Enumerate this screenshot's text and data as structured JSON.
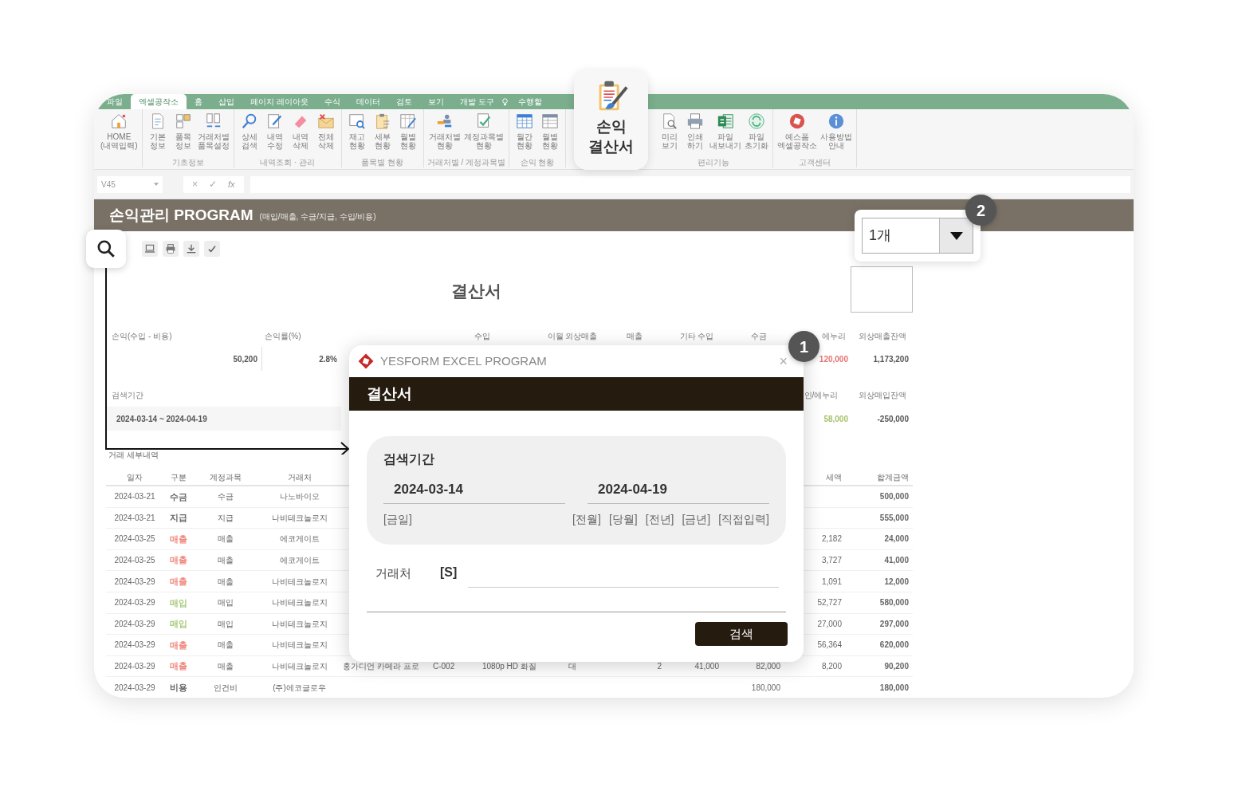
{
  "ribbon_tabs": [
    {
      "label": "파일",
      "selected": false
    },
    {
      "label": "엑셀공작소",
      "selected": true
    },
    {
      "label": "홈",
      "selected": false
    },
    {
      "label": "삽입",
      "selected": false
    },
    {
      "label": "페이지 레이아웃",
      "selected": false
    },
    {
      "label": "수식",
      "selected": false
    },
    {
      "label": "데이터",
      "selected": false
    },
    {
      "label": "검토",
      "selected": false
    },
    {
      "label": "보기",
      "selected": false
    },
    {
      "label": "개발 도구",
      "selected": false
    },
    {
      "label": "수행할",
      "selected": false
    }
  ],
  "ribbon_groups": [
    {
      "buttons": [
        "HOME\n(내역입력)"
      ]
    },
    {
      "label": "기초정보",
      "buttons": [
        "기본\n정보",
        "품목\n정보",
        "거래처별\n품목설정"
      ]
    },
    {
      "label": "내역조회 · 관리",
      "buttons": [
        "상세\n검색",
        "내역\n수정",
        "내역\n삭제",
        "전체\n삭제"
      ]
    },
    {
      "label": "품목별 현황",
      "buttons": [
        "재고\n현황",
        "세부\n현황",
        "월별\n현황"
      ]
    },
    {
      "label": "거래처별 / 계정과목별",
      "buttons": [
        "거래처별\n현황",
        "계정과목별\n현황"
      ]
    },
    {
      "label": "손익 현황",
      "buttons": [
        "월간\n현황",
        "월별\n현황"
      ]
    },
    {
      "label": "편리기능",
      "buttons": [
        "미리\n보기",
        "인쇄\n하기",
        "파일\n내보내기",
        "파일\n초기화"
      ]
    },
    {
      "label": "고객센터",
      "buttons": [
        "예스폼\n엑셀공작소",
        "사용방법\n안내"
      ]
    }
  ],
  "formula_bar": {
    "cell_ref": "V45",
    "buttons": [
      "×",
      "✓"
    ],
    "function_label": "fx"
  },
  "app_header": {
    "title": "손익관리 PROGRAM",
    "subtitle": "(매입/매출, 수금/지급, 수입/비용)"
  },
  "report_title": "결산서",
  "summary": [
    {
      "label": "손익(수입 - 비용)",
      "value": "50,200"
    },
    {
      "label": "손익률(%)",
      "value": "2.8%"
    },
    {
      "label": "수입"
    },
    {
      "label": "이월 외상매출"
    },
    {
      "label": "매출"
    },
    {
      "label": "기타 수입"
    },
    {
      "label": "수금"
    },
    {
      "label": "에누리",
      "value": "120,000",
      "color": "#e57373"
    },
    {
      "label": "외상매출잔액",
      "value": "1,173,200",
      "color": "#555555"
    }
  ],
  "summary_2": [
    {
      "label": "검색기간",
      "value": "2024-03-14 ~ 2024-04-19"
    },
    {
      "label": "인/에누리",
      "value": "58,000",
      "color": "#a5c26b"
    },
    {
      "label": "외상매입잔액",
      "value": "-250,000",
      "color": "#555555"
    }
  ],
  "detail_title": "거래 세부내역",
  "table": {
    "columns": [
      "일자",
      "구분",
      "계정과목",
      "거래처",
      "세액",
      "합계금액"
    ],
    "rows": [
      {
        "date": "2024-03-21",
        "type": "수금",
        "color": "#666666",
        "account": "수금",
        "vendor": "나노바이오",
        "total": "500,000"
      },
      {
        "date": "2024-03-21",
        "type": "지급",
        "color": "#666666",
        "account": "지급",
        "vendor": "나비테크놀로지",
        "total": "555,000"
      },
      {
        "date": "2024-03-25",
        "type": "매출",
        "color": "#f08a80",
        "account": "매출",
        "vendor": "에코게이트",
        "tax": "2,182",
        "total": "24,000"
      },
      {
        "date": "2024-03-25",
        "type": "매출",
        "color": "#f08a80",
        "account": "매출",
        "vendor": "에코게이트",
        "tax": "3,727",
        "total": "41,000"
      },
      {
        "date": "2024-03-29",
        "type": "매출",
        "color": "#f08a80",
        "account": "매출",
        "vendor": "나비테크놀로지",
        "tax": "1,091",
        "total": "12,000"
      },
      {
        "date": "2024-03-29",
        "type": "매입",
        "color": "#a8c97a",
        "account": "매입",
        "vendor": "나비테크놀로지",
        "tax": "52,727",
        "total": "580,000"
      },
      {
        "date": "2024-03-29",
        "type": "매입",
        "color": "#a8c97a",
        "account": "매입",
        "vendor": "나비테크놀로지",
        "tax": "27,000",
        "total": "297,000"
      },
      {
        "date": "2024-03-29",
        "type": "매출",
        "color": "#f08a80",
        "account": "매출",
        "vendor": "나비테크놀로지",
        "tax": "56,364",
        "total": "620,000"
      },
      {
        "date": "2024-03-29",
        "type": "매출",
        "color": "#f08a80",
        "account": "매출",
        "vendor": "나비테크놀로지",
        "item": "홍가디언 카메라 프로",
        "code": "C-002",
        "spec": "1080p HD 화질",
        "unit": "대",
        "qty": "2",
        "price": "41,000",
        "supply": "82,000",
        "tax": "8,200",
        "total": "90,200"
      },
      {
        "date": "2024-03-29",
        "type": "비용",
        "color": "#666666",
        "account": "인건비",
        "vendor": "(주)에코글로우",
        "supply": "180,000",
        "total": "180,000"
      }
    ]
  },
  "feature_button": {
    "label": "손익\n결산서"
  },
  "count_select": {
    "value": "1개"
  },
  "select_badge": "2",
  "dialog_badge": "1",
  "dialog": {
    "app_name": "YESFORM EXCEL PROGRAM",
    "close": "×",
    "title": "결산서",
    "period_label": "검색기간",
    "start_date": "2024-03-14",
    "end_date": "2024-04-19",
    "quick_left": "[금일]",
    "quick_right": [
      "[전월]",
      "[당월]",
      "[전년]",
      "[금년]",
      "[직접입력]"
    ],
    "vendor_label": "거래처",
    "vendor_code": "[S]",
    "search_button": "검색"
  }
}
